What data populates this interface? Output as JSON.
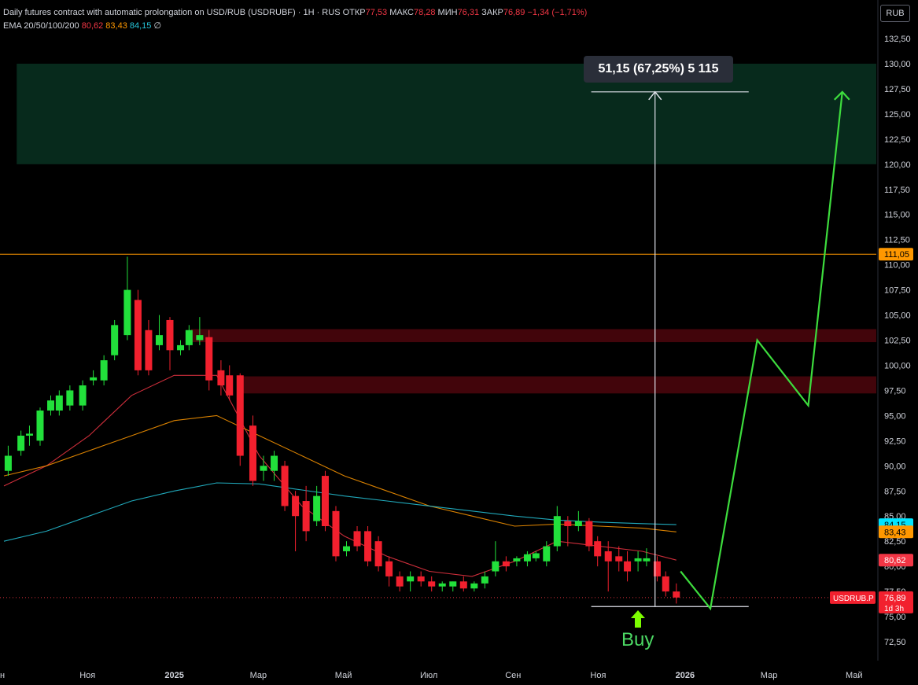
{
  "header": {
    "symbol_line": "Daily futures contract with automatic prolongation on USD/RUB (USDRUBF) · 1H · RUS",
    "open_label": "ОТКР",
    "open": "77,53",
    "high_label": "МАКС",
    "high": "78,28",
    "low_label": "МИН",
    "low": "76,31",
    "close_label": "ЗАКР",
    "close": "76,89",
    "change": "−1,34 (−1,71%)",
    "ema_label": "EMA 20/50/100/200",
    "ema20": "80,62",
    "ema50": "83,43",
    "ema100": "84,15",
    "ema200": "∅"
  },
  "currency_button": "RUB",
  "measure_label": "51,15 (67,25%) 5 115",
  "buy_label": "Buy",
  "chart_data": {
    "type": "candlestick",
    "title": "Daily futures contract with automatic prolongation on USD/RUB (USDRUBF)",
    "ylim": [
      71.0,
      133.5
    ],
    "y_ticks": [
      "72,50",
      "75,00",
      "77,50",
      "80,00",
      "82,50",
      "85,00",
      "87,50",
      "90,00",
      "92,50",
      "95,00",
      "97,50",
      "100,00",
      "102,50",
      "105,00",
      "107,50",
      "110,00",
      "112,50",
      "115,00",
      "117,50",
      "120,00",
      "122,50",
      "125,00",
      "127,50",
      "130,00",
      "132,50"
    ],
    "x_tick_labels": [
      {
        "label": "н",
        "x": 0
      },
      {
        "label": "Ноя",
        "x": 2
      },
      {
        "label": "2025",
        "x": 4
      },
      {
        "label": "Мар",
        "x": 6
      },
      {
        "label": "Май",
        "x": 8
      },
      {
        "label": "Июл",
        "x": 10
      },
      {
        "label": "Сен",
        "x": 12
      },
      {
        "label": "Ноя",
        "x": 14
      },
      {
        "label": "2026",
        "x": 16
      },
      {
        "label": "Мар",
        "x": 18
      },
      {
        "label": "Май",
        "x": 20
      }
    ],
    "candles": [
      {
        "t": 0.1,
        "o": 89.5,
        "h": 92.0,
        "l": 89.0,
        "c": 91.0
      },
      {
        "t": 0.4,
        "o": 91.5,
        "h": 93.5,
        "l": 91.0,
        "c": 93.0
      },
      {
        "t": 0.6,
        "o": 93.0,
        "h": 94.0,
        "l": 92.0,
        "c": 93.2
      },
      {
        "t": 0.85,
        "o": 92.5,
        "h": 95.8,
        "l": 92.0,
        "c": 95.5
      },
      {
        "t": 1.1,
        "o": 95.5,
        "h": 97.0,
        "l": 95.0,
        "c": 96.5
      },
      {
        "t": 1.3,
        "o": 95.5,
        "h": 97.5,
        "l": 95.0,
        "c": 97.0
      },
      {
        "t": 1.55,
        "o": 96.0,
        "h": 98.0,
        "l": 95.5,
        "c": 97.5
      },
      {
        "t": 1.85,
        "o": 96.0,
        "h": 98.5,
        "l": 95.5,
        "c": 98.0
      },
      {
        "t": 2.1,
        "o": 98.5,
        "h": 99.5,
        "l": 98.0,
        "c": 98.8
      },
      {
        "t": 2.35,
        "o": 98.5,
        "h": 101.0,
        "l": 98.0,
        "c": 100.5
      },
      {
        "t": 2.6,
        "o": 101.0,
        "h": 104.5,
        "l": 100.5,
        "c": 104.0
      },
      {
        "t": 2.9,
        "o": 103.0,
        "h": 110.8,
        "l": 102.5,
        "c": 107.5
      },
      {
        "t": 3.15,
        "o": 106.5,
        "h": 107.5,
        "l": 99.0,
        "c": 99.5
      },
      {
        "t": 3.4,
        "o": 103.5,
        "h": 104.5,
        "l": 99.0,
        "c": 99.5
      },
      {
        "t": 3.65,
        "o": 102.0,
        "h": 105.0,
        "l": 101.5,
        "c": 103.0
      },
      {
        "t": 3.9,
        "o": 104.5,
        "h": 104.8,
        "l": 99.5,
        "c": 101.5
      },
      {
        "t": 4.15,
        "o": 101.5,
        "h": 102.5,
        "l": 101.0,
        "c": 102.0
      },
      {
        "t": 4.35,
        "o": 102.0,
        "h": 104.0,
        "l": 101.5,
        "c": 103.5
      },
      {
        "t": 4.6,
        "o": 102.5,
        "h": 104.8,
        "l": 102.0,
        "c": 103.0
      },
      {
        "t": 4.82,
        "o": 102.8,
        "h": 103.5,
        "l": 97.5,
        "c": 98.5
      },
      {
        "t": 5.1,
        "o": 99.5,
        "h": 100.5,
        "l": 97.0,
        "c": 98.0
      },
      {
        "t": 5.3,
        "o": 99.0,
        "h": 100.0,
        "l": 96.5,
        "c": 97.0
      },
      {
        "t": 5.55,
        "o": 99.0,
        "h": 99.2,
        "l": 90.0,
        "c": 91.0
      },
      {
        "t": 5.85,
        "o": 94.0,
        "h": 95.0,
        "l": 88.0,
        "c": 88.5
      },
      {
        "t": 6.1,
        "o": 89.5,
        "h": 91.0,
        "l": 88.5,
        "c": 90.0
      },
      {
        "t": 6.35,
        "o": 89.5,
        "h": 91.5,
        "l": 88.5,
        "c": 91.0
      },
      {
        "t": 6.6,
        "o": 90.0,
        "h": 90.5,
        "l": 85.5,
        "c": 86.0
      },
      {
        "t": 6.85,
        "o": 87.0,
        "h": 87.5,
        "l": 81.5,
        "c": 85.0
      },
      {
        "t": 7.1,
        "o": 86.5,
        "h": 88.0,
        "l": 82.5,
        "c": 83.5
      },
      {
        "t": 7.35,
        "o": 84.5,
        "h": 88.0,
        "l": 84.0,
        "c": 87.0
      },
      {
        "t": 7.55,
        "o": 89.0,
        "h": 89.5,
        "l": 83.5,
        "c": 84.0
      },
      {
        "t": 7.8,
        "o": 85.5,
        "h": 86.0,
        "l": 80.5,
        "c": 81.0
      },
      {
        "t": 8.05,
        "o": 81.5,
        "h": 82.5,
        "l": 81.0,
        "c": 82.0
      },
      {
        "t": 8.3,
        "o": 83.5,
        "h": 84.0,
        "l": 81.5,
        "c": 82.0
      },
      {
        "t": 8.55,
        "o": 83.5,
        "h": 84.0,
        "l": 80.0,
        "c": 80.5
      },
      {
        "t": 8.8,
        "o": 82.5,
        "h": 83.0,
        "l": 79.5,
        "c": 80.0
      },
      {
        "t": 9.05,
        "o": 80.5,
        "h": 81.0,
        "l": 78.0,
        "c": 79.0
      },
      {
        "t": 9.3,
        "o": 79.0,
        "h": 79.5,
        "l": 77.5,
        "c": 78.0
      },
      {
        "t": 9.55,
        "o": 78.5,
        "h": 79.5,
        "l": 77.5,
        "c": 79.0
      },
      {
        "t": 9.8,
        "o": 79.0,
        "h": 79.5,
        "l": 78.0,
        "c": 78.5
      },
      {
        "t": 10.05,
        "o": 78.5,
        "h": 79.0,
        "l": 77.5,
        "c": 78.0
      },
      {
        "t": 10.3,
        "o": 78.0,
        "h": 78.5,
        "l": 77.5,
        "c": 78.3
      },
      {
        "t": 10.55,
        "o": 78.0,
        "h": 78.5,
        "l": 77.5,
        "c": 78.5
      },
      {
        "t": 10.8,
        "o": 78.5,
        "h": 79.0,
        "l": 77.5,
        "c": 77.8
      },
      {
        "t": 11.05,
        "o": 77.8,
        "h": 78.5,
        "l": 77.5,
        "c": 78.3
      },
      {
        "t": 11.3,
        "o": 78.3,
        "h": 79.5,
        "l": 77.8,
        "c": 79.0
      },
      {
        "t": 11.55,
        "o": 79.5,
        "h": 82.5,
        "l": 79.0,
        "c": 80.5
      },
      {
        "t": 11.8,
        "o": 80.5,
        "h": 81.0,
        "l": 79.5,
        "c": 80.0
      },
      {
        "t": 12.05,
        "o": 80.5,
        "h": 81.0,
        "l": 80.0,
        "c": 80.8
      },
      {
        "t": 12.3,
        "o": 80.5,
        "h": 81.5,
        "l": 80.0,
        "c": 81.2
      },
      {
        "t": 12.5,
        "o": 80.8,
        "h": 81.5,
        "l": 80.5,
        "c": 81.3
      },
      {
        "t": 12.75,
        "o": 80.5,
        "h": 82.5,
        "l": 80.0,
        "c": 82.0
      },
      {
        "t": 13.0,
        "o": 82.0,
        "h": 86.0,
        "l": 81.5,
        "c": 85.0
      },
      {
        "t": 13.25,
        "o": 84.5,
        "h": 85.0,
        "l": 82.0,
        "c": 84.0
      },
      {
        "t": 13.5,
        "o": 84.0,
        "h": 85.5,
        "l": 83.5,
        "c": 84.5
      },
      {
        "t": 13.75,
        "o": 84.5,
        "h": 84.8,
        "l": 81.5,
        "c": 82.0
      },
      {
        "t": 13.95,
        "o": 82.5,
        "h": 83.0,
        "l": 80.0,
        "c": 81.0
      },
      {
        "t": 14.2,
        "o": 81.5,
        "h": 82.5,
        "l": 77.5,
        "c": 80.5
      },
      {
        "t": 14.45,
        "o": 81.0,
        "h": 82.0,
        "l": 79.5,
        "c": 80.5
      },
      {
        "t": 14.65,
        "o": 80.5,
        "h": 81.5,
        "l": 78.5,
        "c": 79.5
      },
      {
        "t": 14.9,
        "o": 80.5,
        "h": 81.5,
        "l": 79.5,
        "c": 80.8
      },
      {
        "t": 15.1,
        "o": 80.5,
        "h": 81.8,
        "l": 80.0,
        "c": 80.8
      },
      {
        "t": 15.35,
        "o": 80.5,
        "h": 81.0,
        "l": 78.5,
        "c": 79.0
      },
      {
        "t": 15.55,
        "o": 79.0,
        "h": 79.5,
        "l": 77.0,
        "c": 77.5
      },
      {
        "t": 15.8,
        "o": 77.5,
        "h": 78.3,
        "l": 76.3,
        "c": 76.9
      }
    ],
    "ema_series": [
      {
        "name": "EMA 20",
        "color": "#f23645",
        "points": [
          [
            0,
            88
          ],
          [
            1,
            90
          ],
          [
            2,
            93
          ],
          [
            3,
            97
          ],
          [
            4,
            99
          ],
          [
            5,
            99
          ],
          [
            6,
            91
          ],
          [
            7,
            86
          ],
          [
            8,
            83
          ],
          [
            9,
            81
          ],
          [
            10,
            79.5
          ],
          [
            11,
            79
          ],
          [
            12,
            80.5
          ],
          [
            13,
            82.5
          ],
          [
            14,
            82
          ],
          [
            15,
            81.5
          ],
          [
            15.8,
            80.62
          ]
        ]
      },
      {
        "name": "EMA 50",
        "color": "#ff9800",
        "points": [
          [
            0,
            89
          ],
          [
            1,
            90
          ],
          [
            2,
            91.5
          ],
          [
            3,
            93
          ],
          [
            4,
            94.5
          ],
          [
            5,
            95
          ],
          [
            6,
            93
          ],
          [
            7,
            91
          ],
          [
            8,
            89
          ],
          [
            9,
            87.5
          ],
          [
            10,
            86
          ],
          [
            11,
            85
          ],
          [
            12,
            84
          ],
          [
            13,
            84.2
          ],
          [
            14,
            84
          ],
          [
            15,
            83.8
          ],
          [
            15.8,
            83.43
          ]
        ]
      },
      {
        "name": "EMA 100",
        "color": "#26c6da",
        "points": [
          [
            0,
            82.5
          ],
          [
            1,
            83.5
          ],
          [
            2,
            85.0
          ],
          [
            3,
            86.5
          ],
          [
            4,
            87.5
          ],
          [
            5,
            88.3
          ],
          [
            6,
            88.2
          ],
          [
            7,
            87.6
          ],
          [
            8,
            87.0
          ],
          [
            9,
            86.5
          ],
          [
            10,
            86.0
          ],
          [
            11,
            85.5
          ],
          [
            12,
            85.0
          ],
          [
            13,
            84.6
          ],
          [
            14,
            84.4
          ],
          [
            15,
            84.25
          ],
          [
            15.8,
            84.15
          ]
        ]
      }
    ],
    "horizontal_levels": [
      {
        "price": 111.05,
        "label": "111,05",
        "color": "#ff9800"
      },
      {
        "price": 76.89,
        "label": "76,89",
        "color": "#f23645",
        "dotted": true
      }
    ],
    "zones": [
      {
        "from": 120.0,
        "to": 130.0,
        "x0": 0.3,
        "x1": 20.5,
        "color": "green"
      },
      {
        "from": 102.3,
        "to": 103.6,
        "x0": 4.4,
        "x1": 20.5,
        "color": "red"
      },
      {
        "from": 97.2,
        "to": 98.9,
        "x0": 5.5,
        "x1": 20.5,
        "color": "red"
      }
    ],
    "projection_path": [
      [
        15.9,
        79.5
      ],
      [
        16.6,
        75.8
      ],
      [
        17.7,
        102.5
      ],
      [
        18.9,
        96.0
      ],
      [
        19.7,
        127.2
      ]
    ],
    "measure": {
      "x": 15.3,
      "from": 76.0,
      "to": 127.2,
      "x0": 13.8,
      "x1": 17.5
    },
    "price_labels": [
      {
        "price": 84.15,
        "text": "84,15",
        "bg": "#00e5ff",
        "fg": "#000"
      },
      {
        "price": 83.43,
        "text": "83,43",
        "bg": "#ff9800",
        "fg": "#000"
      },
      {
        "price": 80.62,
        "text": "80,62",
        "bg": "#f23645",
        "fg": "#fff"
      }
    ],
    "current": {
      "price": 76.89,
      "text": "76,89",
      "timer": "1d 3h",
      "symbol": "USDRUB.P"
    }
  }
}
